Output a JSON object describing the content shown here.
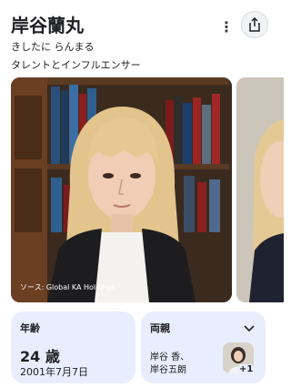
{
  "knowledge_panel": {
    "title": "岸谷蘭丸",
    "reading": "きしたに らんまる",
    "subtitle": "タレントとインフルエンサー",
    "icons": {
      "more": "more-vert-icon",
      "share": "share-icon"
    }
  },
  "gallery": {
    "source_caption": "ソース: Global KA Holdings"
  },
  "facts": {
    "age": {
      "label": "年齢",
      "value": "24 歳",
      "date": "2001年7月7日"
    },
    "parents": {
      "label": "両親",
      "names_line1": "岸谷 香、",
      "names_line2": "岸谷五朗",
      "more_count": "+1"
    }
  },
  "colors": {
    "card_background": "#e8eefd",
    "text": "#202124"
  }
}
